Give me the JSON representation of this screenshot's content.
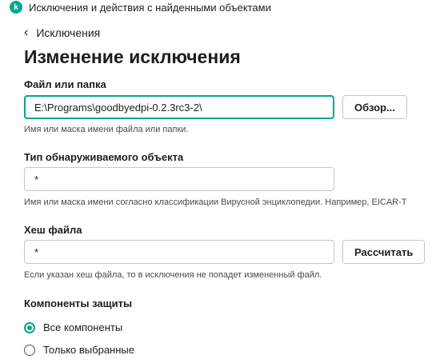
{
  "window": {
    "icon_letter": "k",
    "title": "Исключения и действия с найденными объектами"
  },
  "nav": {
    "back_label": "Исключения"
  },
  "page": {
    "title": "Изменение исключения"
  },
  "file_field": {
    "label": "Файл или папка",
    "value": "E:\\Programs\\goodbyedpi-0.2.3rc3-2\\",
    "browse_label": "Обзор...",
    "hint": "Имя или маска имени файла или папки."
  },
  "object_type_field": {
    "label": "Тип обнаруживаемого объекта",
    "value": "*",
    "hint": "Имя или маска имени согласно классификации Вирусной энциклопедии. Например, EICAR-T"
  },
  "hash_field": {
    "label": "Хеш файла",
    "value": "*",
    "calculate_label": "Рассчитать",
    "hint": "Если указан хеш файла, то в исключения не попадет измененный файл."
  },
  "protection_components": {
    "label": "Компоненты защиты",
    "options": [
      {
        "label": "Все компоненты",
        "checked": true
      },
      {
        "label": "Только выбранные",
        "checked": false
      }
    ]
  },
  "colors": {
    "accent": "#00a88e",
    "border": "#c7c7c7",
    "text": "#1d1d1b"
  }
}
